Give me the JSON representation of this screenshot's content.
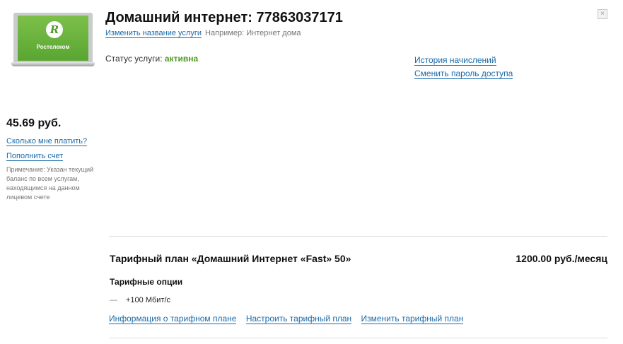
{
  "service": {
    "title": "Домашний интернет: 77863037171",
    "rename_link": "Изменить название услуги",
    "rename_hint": "Например: Интернет дома",
    "status_label": "Статус услуги:",
    "status_value": "активна",
    "brand": "Ростелеком",
    "logo_glyph": "R"
  },
  "right_links": {
    "history": "История начислений",
    "change_password": "Сменить пароль доступа"
  },
  "account": {
    "balance": "45.69 руб.",
    "how_much": "Сколько мне платить?",
    "top_up": "Пополнить счет",
    "note": "Примечание: Указан текущий баланс по всем услугам, находящимся на данном лицевом счете"
  },
  "tariff": {
    "plan_title": "Тарифный план «Домашний Интернет «Fast» 50»",
    "price": "1200.00 руб./месяц",
    "options_heading": "Тарифные опции",
    "option_dash": "—",
    "option_1": "+100 Мбит/с",
    "link_info": "Информация о тарифном плане",
    "link_configure": "Настроить тарифный план",
    "link_change": "Изменить тарифный план"
  },
  "window": {
    "close_glyph": "×"
  },
  "colors": {
    "link": "#1a6aa8",
    "active": "#4e9a22",
    "brand_green": "#5aa532"
  }
}
